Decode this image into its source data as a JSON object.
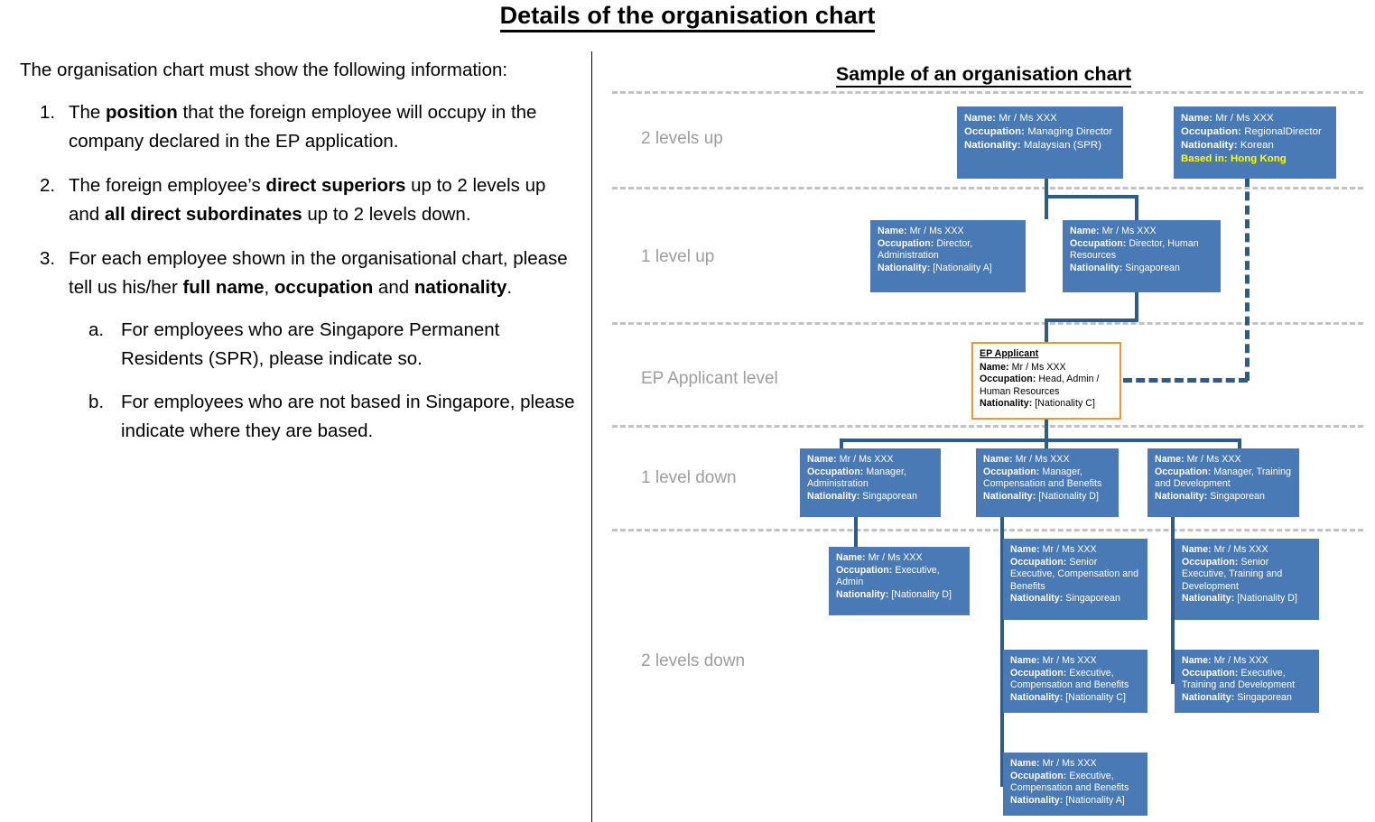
{
  "page": {
    "title": "Details of the organisation chart"
  },
  "left": {
    "intro": "The organisation chart must show the following information:",
    "items": [
      {
        "marker": "1.",
        "parts": [
          {
            "t": "The ",
            "b": false
          },
          {
            "t": "position",
            "b": true
          },
          {
            "t": " that the foreign employee will occupy in the company declared in the EP application.",
            "b": false
          }
        ]
      },
      {
        "marker": "2.",
        "parts": [
          {
            "t": "The foreign employee’s ",
            "b": false
          },
          {
            "t": "direct superiors",
            "b": true
          },
          {
            "t": " up to 2 levels up and ",
            "b": false
          },
          {
            "t": "all direct subordinates",
            "b": true
          },
          {
            "t": " up to 2 levels down.",
            "b": false
          }
        ]
      },
      {
        "marker": "3.",
        "parts": [
          {
            "t": "For each employee shown in the organisational chart, please tell us his/her ",
            "b": false
          },
          {
            "t": "full name",
            "b": true
          },
          {
            "t": ", ",
            "b": false
          },
          {
            "t": "occupation",
            "b": true
          },
          {
            "t": " and ",
            "b": false
          },
          {
            "t": "nationality",
            "b": true
          },
          {
            "t": ".",
            "b": false
          }
        ],
        "sub": [
          {
            "marker": "a.",
            "parts": [
              {
                "t": "For employees who are Singapore Permanent Residents (SPR), please indicate so.",
                "b": false
              }
            ]
          },
          {
            "marker": "b.",
            "parts": [
              {
                "t": "For employees who are not based in Singapore, please indicate where they are based.",
                "b": false
              }
            ]
          }
        ]
      }
    ]
  },
  "chart": {
    "title": "Sample of an organisation chart",
    "levels": [
      {
        "label": "2 levels up"
      },
      {
        "label": "1 level up"
      },
      {
        "label": "EP Applicant  level"
      },
      {
        "label": "1 level down"
      },
      {
        "label": "2 levels down"
      }
    ],
    "field_labels": {
      "name": "Name:",
      "occupation": "Occupation:",
      "nationality": "Nationality:",
      "based_in": "Based in:",
      "applicant_title": "EP Applicant"
    },
    "colors": {
      "node_fill": "#4a7ab5",
      "node_text": "#ffffff",
      "connector": "#2e5c8a",
      "applicant_border": "#ed9434",
      "highlight_text": "#ffff00",
      "separator": "#c2c2c2",
      "level_label": "#9d9d9d"
    },
    "nodes": {
      "md": {
        "name": "Mr / Ms XXX",
        "occupation": "Managing Director",
        "nationality": " Malaysian (SPR)"
      },
      "regional": {
        "name": "Mr / Ms XXX",
        "occupation": "RegionalDirector",
        "nationality": "Korean",
        "based_in": "Hong Kong"
      },
      "dir_admin": {
        "name": "Mr / Ms XXX",
        "occupation": "Director, Administration",
        "nationality": "[Nationality A]"
      },
      "dir_hr": {
        "name": "Mr / Ms XXX",
        "occupation": "Director, Human Resources",
        "nationality": "Singaporean"
      },
      "applicant": {
        "name": "Mr / Ms XXX",
        "occupation": "Head, Admin / Human Resources",
        "nationality": "[Nationality C]"
      },
      "mgr_admin": {
        "name": "Mr / Ms XXX",
        "occupation": "Manager, Administration",
        "nationality": "Singaporean"
      },
      "mgr_comp": {
        "name": "Mr / Ms XXX",
        "occupation": "Manager, Compensation and Benefits",
        "nationality": "[Nationality D]"
      },
      "mgr_train": {
        "name": "Mr / Ms XXX",
        "occupation": "Manager, Training and Development",
        "nationality": "Singaporean"
      },
      "exec_admin": {
        "name": "Mr / Ms XXX",
        "occupation": "Executive, Admin",
        "nationality": "[Nationality D]"
      },
      "sr_exec_comp": {
        "name": "Mr / Ms XXX",
        "occupation": "Senior Executive, Compensation and Benefits",
        "nationality": "Singaporean"
      },
      "sr_exec_train": {
        "name": "Mr / Ms XXX",
        "occupation": "Senior Executive, Training and Development",
        "nationality": "[Nationality D]"
      },
      "exec_comp_c": {
        "name": "Mr / Ms XXX",
        "occupation": "Executive, Compensation and Benefits",
        "nationality": "[Nationality C]"
      },
      "exec_train": {
        "name": "Mr / Ms XXX",
        "occupation": "Executive, Training and Development",
        "nationality": "Singaporean"
      },
      "exec_comp_a": {
        "name": "Mr / Ms XXX",
        "occupation": "Executive, Compensation and Benefits",
        "nationality": "[Nationality A]"
      }
    }
  }
}
